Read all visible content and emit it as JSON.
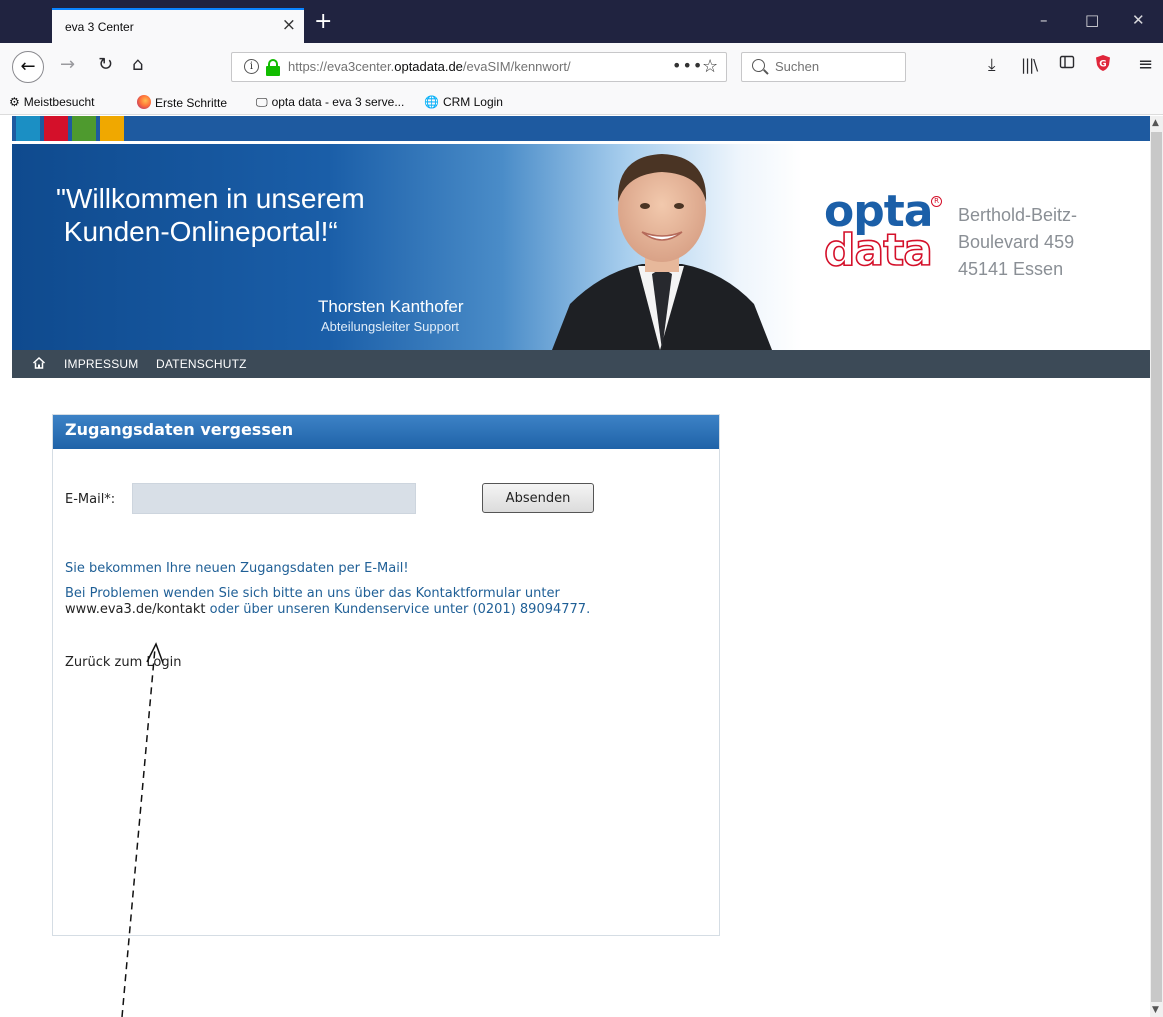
{
  "browser": {
    "tab_title": "eva 3 Center",
    "tab_close": "×",
    "new_tab": "+",
    "window_controls": {
      "minimize": "–",
      "maximize": "□",
      "close": "✕"
    },
    "url": {
      "prefix": "https://eva3center.",
      "domain": "optadata.de",
      "suffix": "/evaSIM/kennwort/"
    },
    "url_more": "•••",
    "url_bookmark": "☆",
    "search_placeholder": "Suchen",
    "icons": [
      "back-icon",
      "forward-icon",
      "reload-icon",
      "home-icon",
      "info-icon",
      "lock-icon",
      "download-icon",
      "library-icon",
      "sidebar-icon",
      "shield-extension-icon",
      "menu-icon"
    ],
    "bookmarks": [
      {
        "label": "Meistbesucht",
        "icon": "gear-icon"
      },
      {
        "label": "Erste Schritte",
        "icon": "firefox-icon"
      },
      {
        "label": "opta data - eva 3 serve...",
        "icon": "monitor-icon"
      },
      {
        "label": "CRM Login",
        "icon": "globe-icon"
      }
    ]
  },
  "banner": {
    "welcome": "\"Willkommen in unserem\n Kunden-Onlineportal!“",
    "person_name": "Thorsten Kanthofer",
    "person_role": "Abteilungsleiter Support",
    "logo_top": "opta",
    "logo_bottom": "data",
    "logo_reg": "R",
    "address_line1": "Berthold-Beitz-",
    "address_line2": "Boulevard 459",
    "address_line3": "45141 Essen",
    "brand_colors": {
      "blue": "#1b5fa8",
      "red": "#d4102a"
    },
    "color_squares": [
      "#1b8fc4",
      "#d4102a",
      "#4e9a2e",
      "#f0a800"
    ]
  },
  "menu": {
    "home_icon": "home-icon",
    "items": [
      "IMPRESSUM",
      "DATENSCHUTZ"
    ]
  },
  "form": {
    "title": "Zugangsdaten vergessen",
    "email_label": "E-Mail*:",
    "email_value": "",
    "submit_label": "Absenden",
    "info_line1": "Sie bekommen Ihre neuen Zugangsdaten per E-Mail!",
    "info_line2": "Bei Problemen wenden Sie sich bitte an uns über das Kontaktformular unter",
    "info_link": "www.eva3.de/kontakt",
    "info_line3_rest": " oder über unseren Kundenservice unter (0201) 89094777.",
    "back_link": "Zurück zum Login"
  }
}
